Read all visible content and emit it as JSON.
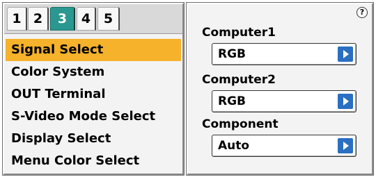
{
  "tabs": [
    {
      "label": "1",
      "active": false
    },
    {
      "label": "2",
      "active": false
    },
    {
      "label": "3",
      "active": true
    },
    {
      "label": "4",
      "active": false
    },
    {
      "label": "5",
      "active": false
    }
  ],
  "menu": {
    "items": [
      {
        "label": "Signal Select",
        "selected": true
      },
      {
        "label": "Color System",
        "selected": false
      },
      {
        "label": "OUT Terminal",
        "selected": false
      },
      {
        "label": "S-Video Mode Select",
        "selected": false
      },
      {
        "label": "Display Select",
        "selected": false
      },
      {
        "label": "Menu Color Select",
        "selected": false
      }
    ]
  },
  "help": {
    "icon": "help-icon",
    "symbol": "?"
  },
  "settings": [
    {
      "label": "Computer1",
      "value": "RGB"
    },
    {
      "label": "Computer2",
      "value": "RGB"
    },
    {
      "label": "Component",
      "value": "Auto"
    }
  ],
  "colors": {
    "active_tab": "#2a9790",
    "selected_item": "#f6b22a",
    "dropdown_arrow": "#2a6fc1",
    "panel_background": "#f3f3f3"
  }
}
